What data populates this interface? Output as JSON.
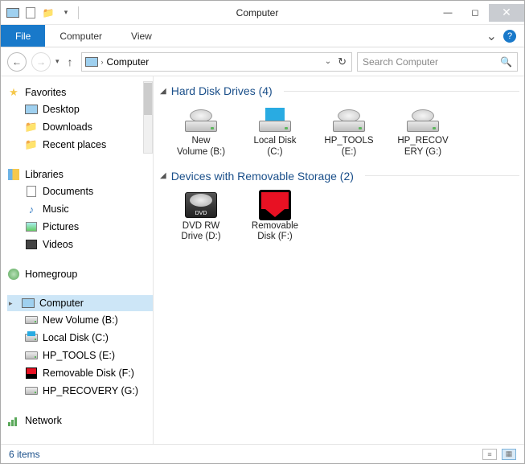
{
  "window": {
    "title": "Computer",
    "qat_dropdown": "▾"
  },
  "ribbon": {
    "file": "File",
    "tabs": [
      "Computer",
      "View"
    ],
    "expand_glyph": "⌄"
  },
  "nav": {
    "back_glyph": "←",
    "forward_glyph": "→",
    "recent_glyph": "▾",
    "up_glyph": "↑",
    "address_root": "Computer",
    "address_crumb_glyph": "›",
    "dropdown_glyph": "⌄",
    "refresh_glyph": "↻",
    "search_placeholder": "Search Computer",
    "search_glyph": "🔍"
  },
  "tree": {
    "favorites": {
      "label": "Favorites",
      "items": [
        {
          "label": "Desktop",
          "icon": "monitor"
        },
        {
          "label": "Downloads",
          "icon": "folder"
        },
        {
          "label": "Recent places",
          "icon": "folder"
        }
      ]
    },
    "libraries": {
      "label": "Libraries",
      "items": [
        {
          "label": "Documents",
          "icon": "doc"
        },
        {
          "label": "Music",
          "icon": "music"
        },
        {
          "label": "Pictures",
          "icon": "pic"
        },
        {
          "label": "Videos",
          "icon": "vid"
        }
      ]
    },
    "homegroup": {
      "label": "Homegroup"
    },
    "computer": {
      "label": "Computer",
      "items": [
        {
          "label": "New Volume (B:)",
          "icon": "drive"
        },
        {
          "label": "Local Disk (C:)",
          "icon": "windrive"
        },
        {
          "label": "HP_TOOLS (E:)",
          "icon": "drive"
        },
        {
          "label": "Removable Disk (F:)",
          "icon": "rem"
        },
        {
          "label": "HP_RECOVERY (G:)",
          "icon": "drive"
        }
      ]
    },
    "network": {
      "label": "Network"
    }
  },
  "content": {
    "sections": [
      {
        "title": "Hard Disk Drives (4)",
        "items": [
          {
            "line1": "New",
            "line2": "Volume (B:)",
            "kind": "hdd"
          },
          {
            "line1": "Local Disk",
            "line2": "(C:)",
            "kind": "hdd-win"
          },
          {
            "line1": "HP_TOOLS",
            "line2": "(E:)",
            "kind": "hdd"
          },
          {
            "line1": "HP_RECOV",
            "line2": "ERY (G:)",
            "kind": "hdd"
          }
        ]
      },
      {
        "title": "Devices with Removable Storage (2)",
        "items": [
          {
            "line1": "DVD RW",
            "line2": "Drive (D:)",
            "kind": "dvd"
          },
          {
            "line1": "Removable",
            "line2": "Disk (F:)",
            "kind": "rem"
          }
        ]
      }
    ]
  },
  "status": {
    "text": "6 items"
  }
}
